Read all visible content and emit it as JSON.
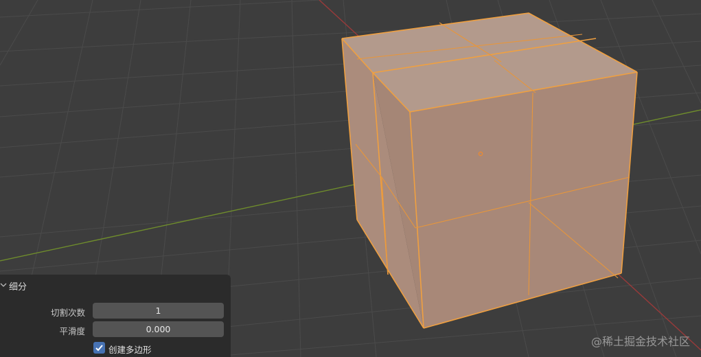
{
  "viewport": {
    "background": "#3d3d3d",
    "grid_color": "#4c4c4c",
    "x_axis_color": "#9a3a3a",
    "y_axis_color": "#6f8d2c",
    "selection_color": "#f0a040",
    "cube_face_color": "#b59484"
  },
  "operator_panel": {
    "title": "细分",
    "collapse_icon": "chevron-down-icon",
    "fields": {
      "cuts_label": "切割次数",
      "cuts_value": "1",
      "smoothness_label": "平滑度",
      "smoothness_value": "0.000"
    },
    "create_ngons": {
      "label": "创建多边形",
      "checked": true
    }
  },
  "watermark": "@稀土掘金技术社区"
}
